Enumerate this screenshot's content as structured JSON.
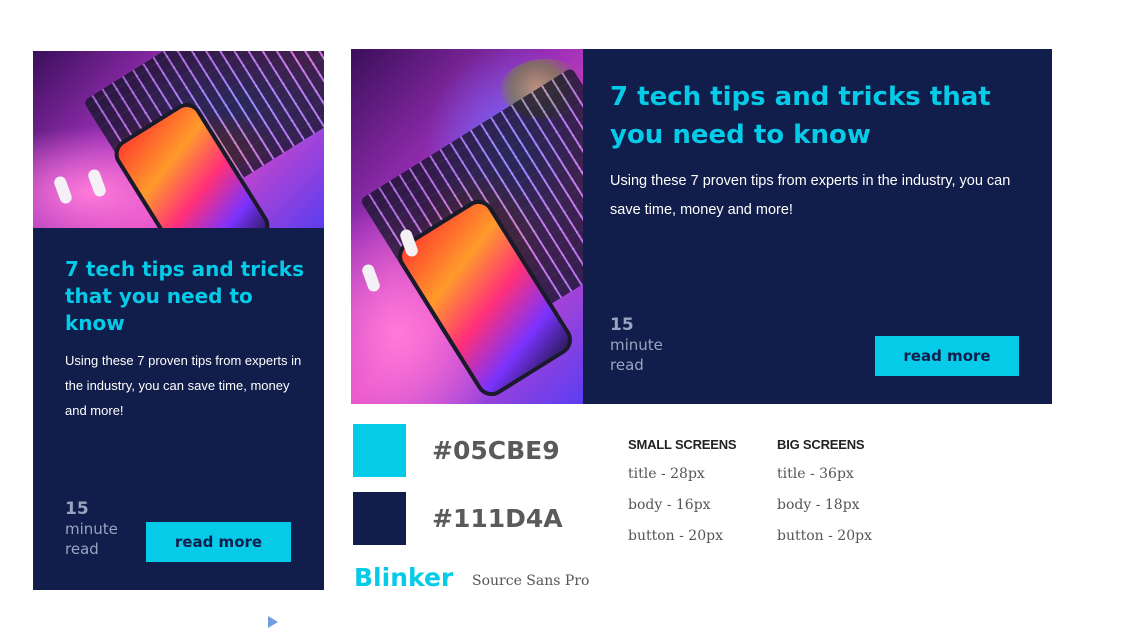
{
  "colors": {
    "accent": "#05CBE9",
    "dark": "#111D4A"
  },
  "card_small": {
    "title": "7 tech tips and tricks that you need to know",
    "body": "Using these 7 proven tips from experts in the industry, you can save time, money and more!",
    "minutes": "15",
    "minutes_word1": "minute",
    "minutes_word2": "read",
    "button": "read more",
    "image_icon": "laptop-photo"
  },
  "card_big": {
    "title": "7 tech tips and tricks that you need to know",
    "body": "Using these 7 proven tips from experts in the industry, you can save time, money and more!",
    "minutes": "15",
    "minutes_word1": "minute",
    "minutes_word2": "read",
    "button": "read more",
    "image_icon": "laptop-photo"
  },
  "style_guide": {
    "swatches": [
      {
        "hex": "#05CBE9"
      },
      {
        "hex": "#111D4A"
      }
    ],
    "small_screens": {
      "heading": "SMALL SCREENS",
      "title": "title - 28px",
      "body": "body - 16px",
      "button": "button - 20px"
    },
    "big_screens": {
      "heading": "BIG SCREENS",
      "title": "title - 36px",
      "body": "body - 18px",
      "button": "button - 20px"
    },
    "font_heading": "Blinker",
    "font_body": "Source Sans Pro"
  }
}
